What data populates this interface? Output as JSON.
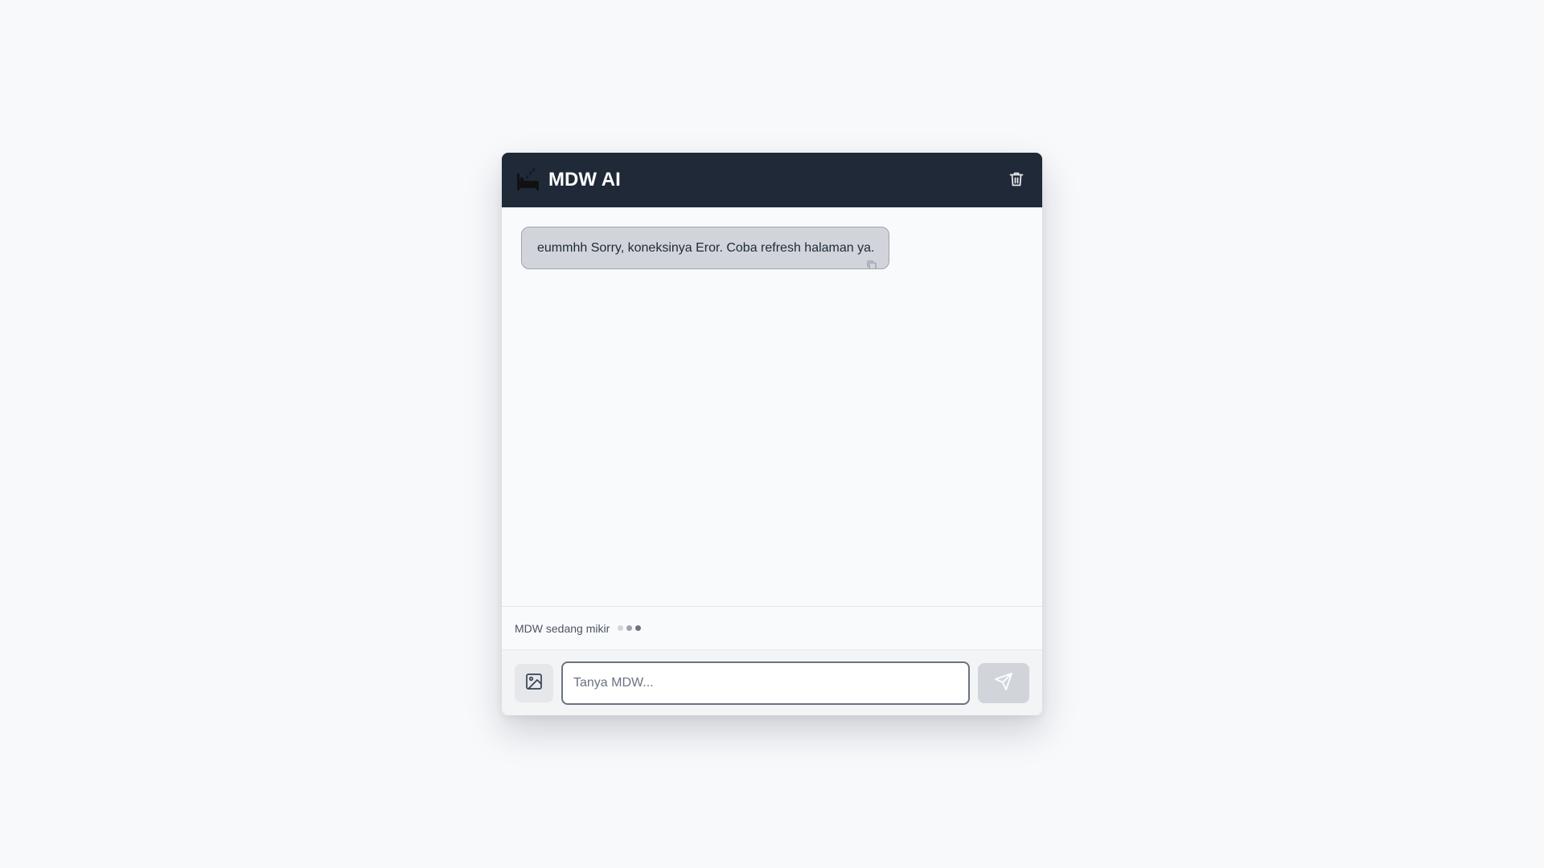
{
  "header": {
    "title": "MDW AI",
    "logo_icon": "sleeping-bed-icon",
    "clear_icon": "trash-icon"
  },
  "messages": [
    {
      "role": "assistant",
      "text": "eummhh Sorry, koneksinya Eror. Coba refresh halaman ya.",
      "icon": "copy-icon"
    }
  ],
  "status": {
    "typing_text": "MDW sedang mikir",
    "dots_colors": [
      "#d1d5db",
      "#9ca3af",
      "#6b7280"
    ]
  },
  "input": {
    "placeholder": "Tanya MDW...",
    "value": "",
    "image_icon": "image-icon",
    "send_icon": "send-icon"
  },
  "colors": {
    "header_bg": "#1f2937",
    "bubble_bg": "#d1d5db",
    "send_bg": "#d1d5db"
  }
}
